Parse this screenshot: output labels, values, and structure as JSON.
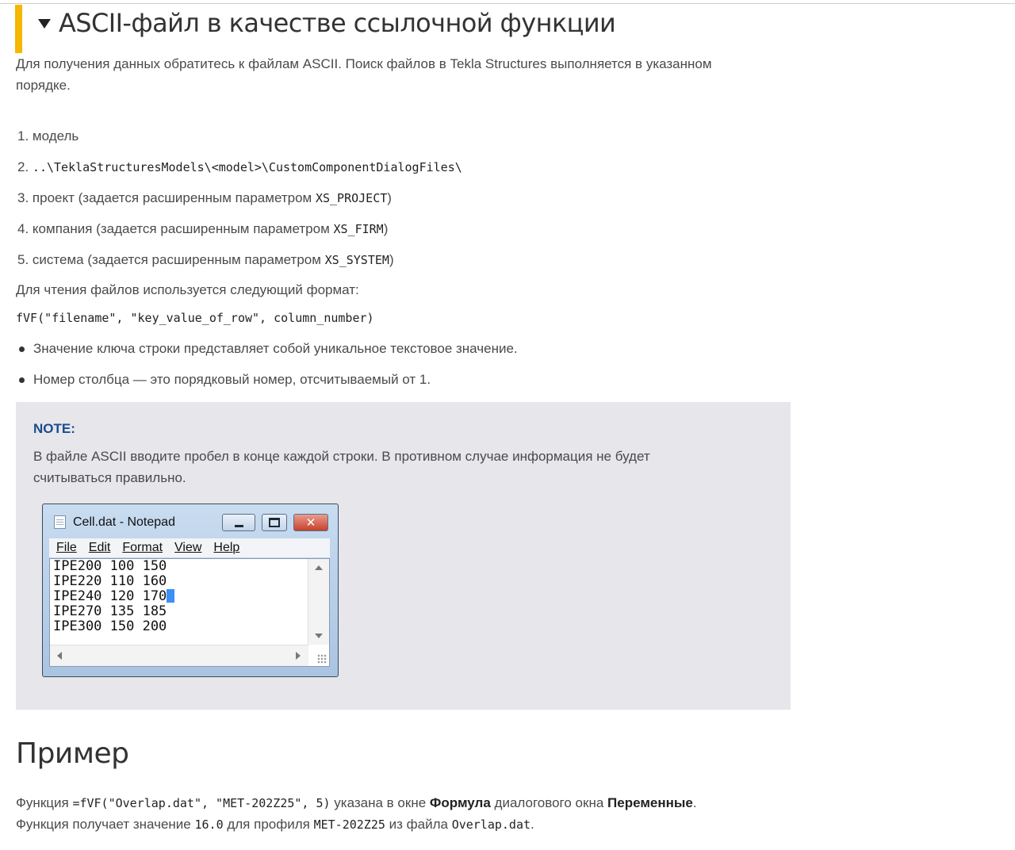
{
  "section": {
    "title": "ASCII-файл в качестве ссылочной функции",
    "intro": "Для получения данных обратитесь к файлам ASCII. Поиск файлов в Tekla Structures выполняется в указанном",
    "intro2": "порядке."
  },
  "search_order": [
    {
      "num": "1.",
      "text": "модель"
    },
    {
      "num": "2.",
      "code": "..\\TeklaStructuresModels\\<model>\\CustomComponentDialogFiles\\"
    },
    {
      "num": "3.",
      "text": "проект (задается расширенным параметром",
      "code": "XS_PROJECT",
      "tail": ")"
    },
    {
      "num": "4.",
      "text": "компания (задается расширенным параметром",
      "code": "XS_FIRM",
      "tail": ")"
    },
    {
      "num": "5.",
      "text": "система (задается расширенным параметром",
      "code": "XS_SYSTEM",
      "tail": ")"
    }
  ],
  "format_label": "Для чтения файлов используется следующий формат:",
  "format_code": "fVF(\"filename\", \"key_value_of_row\", column_number)",
  "bullets": [
    "Значение ключа строки представляет собой уникальное текстовое значение.",
    "Номер столбца — это порядковый номер, отсчитываемый от 1."
  ],
  "note": {
    "title": "NOTE:",
    "line1": "В файле ASCII вводите пробел в конце каждой строки. В противном случае информация не будет",
    "line2": "считываться правильно."
  },
  "notepad": {
    "title": "Cell.dat - Notepad",
    "menu": [
      "File",
      "Edit",
      "Format",
      "View",
      "Help"
    ],
    "lines": [
      "IPE200 100 150",
      "IPE220 110 160",
      "IPE240 120 170",
      "IPE270 135 185",
      "IPE300 150 200"
    ],
    "close_glyph": "✕"
  },
  "example": {
    "heading": "Пример",
    "p1_a": "Функция",
    "p1_code": "=fVF(\"Overlap.dat\", \"MET-202Z25\", 5)",
    "p1_b": "указана в окне",
    "p1_bold1": "Формула",
    "p1_c": "диалогового окна",
    "p1_bold2": "Переменные",
    "p1_d": ".",
    "p2_a": "Функция получает значение",
    "p2_code1": "16.0",
    "p2_b": "для профиля",
    "p2_code2": "MET-202Z25",
    "p2_c": "из файла",
    "p2_code3": "Overlap.dat",
    "p2_d": "."
  }
}
